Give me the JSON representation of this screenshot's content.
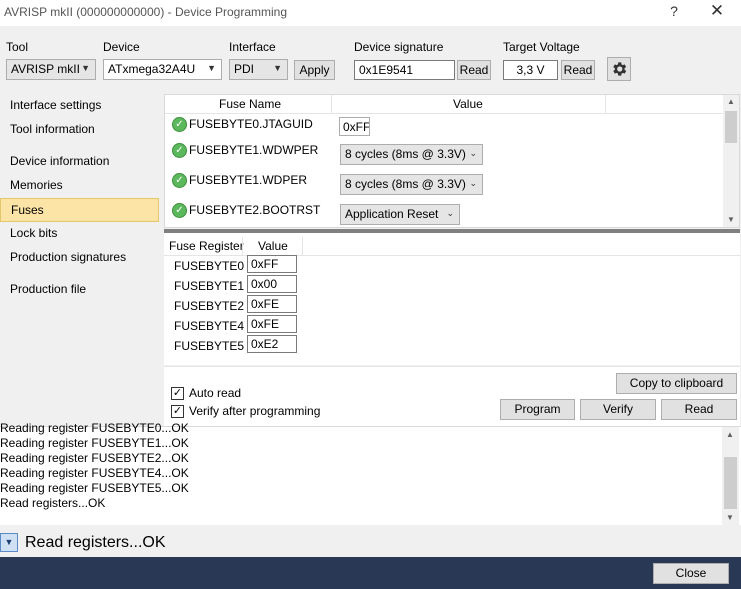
{
  "window": {
    "title": "AVRISP mkII (000000000000) - Device Programming",
    "help_glyph": "?",
    "close_glyph": "✕"
  },
  "toolbar": {
    "tool_label": "Tool",
    "tool_value": "AVRISP mkII",
    "device_label": "Device",
    "device_value": "ATxmega32A4U",
    "interface_label": "Interface",
    "interface_value": "PDI",
    "apply_label": "Apply",
    "signature_label": "Device signature",
    "signature_value": "0x1E9541",
    "signature_read_label": "Read",
    "voltage_label": "Target Voltage",
    "voltage_value": "3,3 V",
    "voltage_read_label": "Read",
    "settings_icon": "gear-icon"
  },
  "sidebar": {
    "items": [
      {
        "label": "Interface settings"
      },
      {
        "label": "Tool information"
      },
      {
        "label": "Device information"
      },
      {
        "label": "Memories"
      },
      {
        "label": "Fuses"
      },
      {
        "label": "Lock bits"
      },
      {
        "label": "Production signatures"
      },
      {
        "label": "Production file"
      }
    ],
    "selected": "Fuses"
  },
  "fuses": {
    "col_name": "Fuse Name",
    "col_value": "Value",
    "rows": [
      {
        "name": "FUSEBYTE0.JTAGUID",
        "value": "0xFF",
        "kind": "text"
      },
      {
        "name": "FUSEBYTE1.WDWPER",
        "value": "8 cycles (8ms @ 3.3V)",
        "kind": "select"
      },
      {
        "name": "FUSEBYTE1.WDPER",
        "value": "8 cycles (8ms @ 3.3V)",
        "kind": "select"
      },
      {
        "name": "FUSEBYTE2.BOOTRST",
        "value": "Application Reset",
        "kind": "select"
      }
    ]
  },
  "registers": {
    "col_register": "Fuse Register",
    "col_value": "Value",
    "rows": [
      {
        "name": "FUSEBYTE0",
        "value": "0xFF"
      },
      {
        "name": "FUSEBYTE1",
        "value": "0x00"
      },
      {
        "name": "FUSEBYTE2",
        "value": "0xFE"
      },
      {
        "name": "FUSEBYTE4",
        "value": "0xFE"
      },
      {
        "name": "FUSEBYTE5",
        "value": "0xE2"
      }
    ]
  },
  "controls": {
    "auto_read_label": "Auto read",
    "auto_read_checked": true,
    "verify_label": "Verify after programming",
    "verify_checked": true,
    "copy_label": "Copy to clipboard",
    "program_label": "Program",
    "verify_button_label": "Verify",
    "read_label": "Read"
  },
  "log": {
    "lines": [
      "Reading register FUSEBYTE0...OK",
      "Reading register FUSEBYTE1...OK",
      "Reading register FUSEBYTE2...OK",
      "Reading register FUSEBYTE4...OK",
      "Reading register FUSEBYTE5...OK",
      "Read registers...OK"
    ]
  },
  "status": {
    "text": "Read registers...OK"
  },
  "footer": {
    "close_label": "Close"
  },
  "colors": {
    "selected_item": "#fce4a6",
    "footer_bg": "#293955",
    "ok_green": "#5cb85c"
  }
}
